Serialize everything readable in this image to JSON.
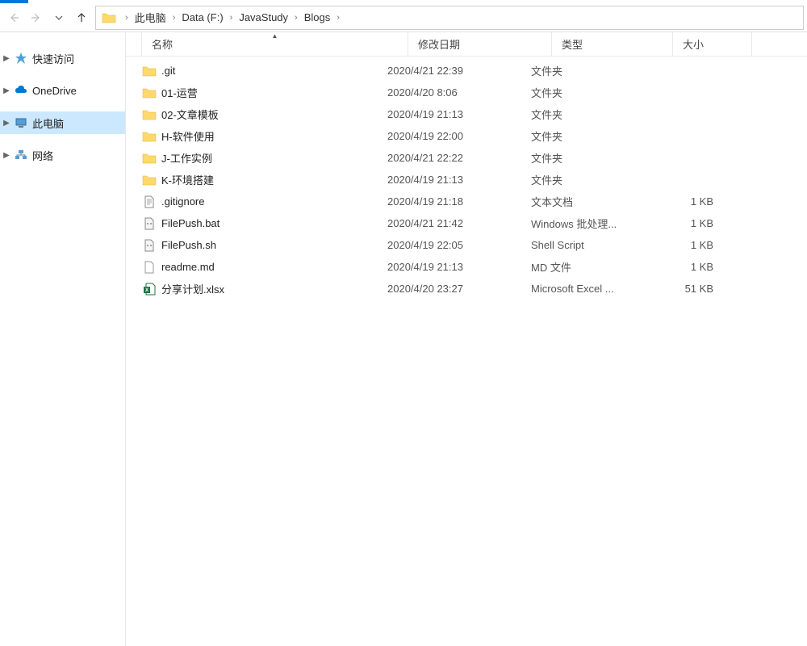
{
  "breadcrumb": [
    "此电脑",
    "Data (F:)",
    "JavaStudy",
    "Blogs"
  ],
  "sidebar": [
    {
      "label": "快速访问",
      "icon": "star",
      "expandable": true,
      "selected": false
    },
    {
      "label": "OneDrive",
      "icon": "cloud",
      "expandable": true,
      "selected": false
    },
    {
      "label": "此电脑",
      "icon": "pc",
      "expandable": true,
      "selected": true
    },
    {
      "label": "网络",
      "icon": "net",
      "expandable": true,
      "selected": false
    }
  ],
  "columns": {
    "name": "名称",
    "date": "修改日期",
    "type": "类型",
    "size": "大小"
  },
  "files": [
    {
      "name": ".git",
      "date": "2020/4/21 22:39",
      "type": "文件夹",
      "size": "",
      "icon": "folder"
    },
    {
      "name": "01-运营",
      "date": "2020/4/20 8:06",
      "type": "文件夹",
      "size": "",
      "icon": "folder"
    },
    {
      "name": "02-文章模板",
      "date": "2020/4/19 21:13",
      "type": "文件夹",
      "size": "",
      "icon": "folder"
    },
    {
      "name": "H-软件使用",
      "date": "2020/4/19 22:00",
      "type": "文件夹",
      "size": "",
      "icon": "folder"
    },
    {
      "name": "J-工作实例",
      "date": "2020/4/21 22:22",
      "type": "文件夹",
      "size": "",
      "icon": "folder"
    },
    {
      "name": "K-环境搭建",
      "date": "2020/4/19 21:13",
      "type": "文件夹",
      "size": "",
      "icon": "folder"
    },
    {
      "name": ".gitignore",
      "date": "2020/4/19 21:18",
      "type": "文本文档",
      "size": "1 KB",
      "icon": "txt"
    },
    {
      "name": "FilePush.bat",
      "date": "2020/4/21 21:42",
      "type": "Windows 批处理...",
      "size": "1 KB",
      "icon": "bat"
    },
    {
      "name": "FilePush.sh",
      "date": "2020/4/19 22:05",
      "type": "Shell Script",
      "size": "1 KB",
      "icon": "bat"
    },
    {
      "name": "readme.md",
      "date": "2020/4/19 21:13",
      "type": "MD 文件",
      "size": "1 KB",
      "icon": "file"
    },
    {
      "name": "分享计划.xlsx",
      "date": "2020/4/20 23:27",
      "type": "Microsoft Excel ...",
      "size": "51 KB",
      "icon": "xls"
    }
  ]
}
